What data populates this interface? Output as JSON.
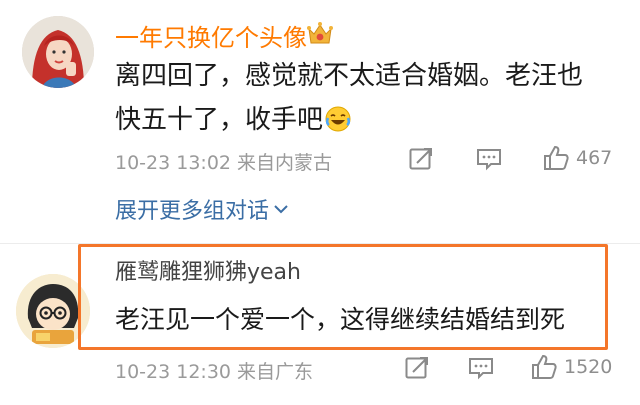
{
  "comments": [
    {
      "username": "一年只换亿个头像",
      "text_line1": "离四回了，感觉就不太适合婚姻。老汪也",
      "text_line2": "快五十了，收手吧",
      "meta": "10-23 13:02  来自内蒙古",
      "actions": {
        "share_icon": "share-icon",
        "comment_icon": "comment-icon",
        "like_icon": "thumbs-up-icon",
        "likes": "467"
      },
      "expand_label": "展开更多组对话"
    },
    {
      "username": "雁鹫雕狸狮狒yeah",
      "text": "老汪见一个爱一个，这得继续结婚结到死",
      "meta": "10-23 12:30  来自广东",
      "actions": {
        "share_icon": "share-icon",
        "comment_icon": "comment-icon",
        "like_icon": "thumbs-up-icon",
        "likes": "1520"
      }
    }
  ],
  "colors": {
    "username": "#ff7a00",
    "link": "#3b6ea5",
    "meta": "#9a9a9a",
    "highlight": "#f4762a"
  }
}
